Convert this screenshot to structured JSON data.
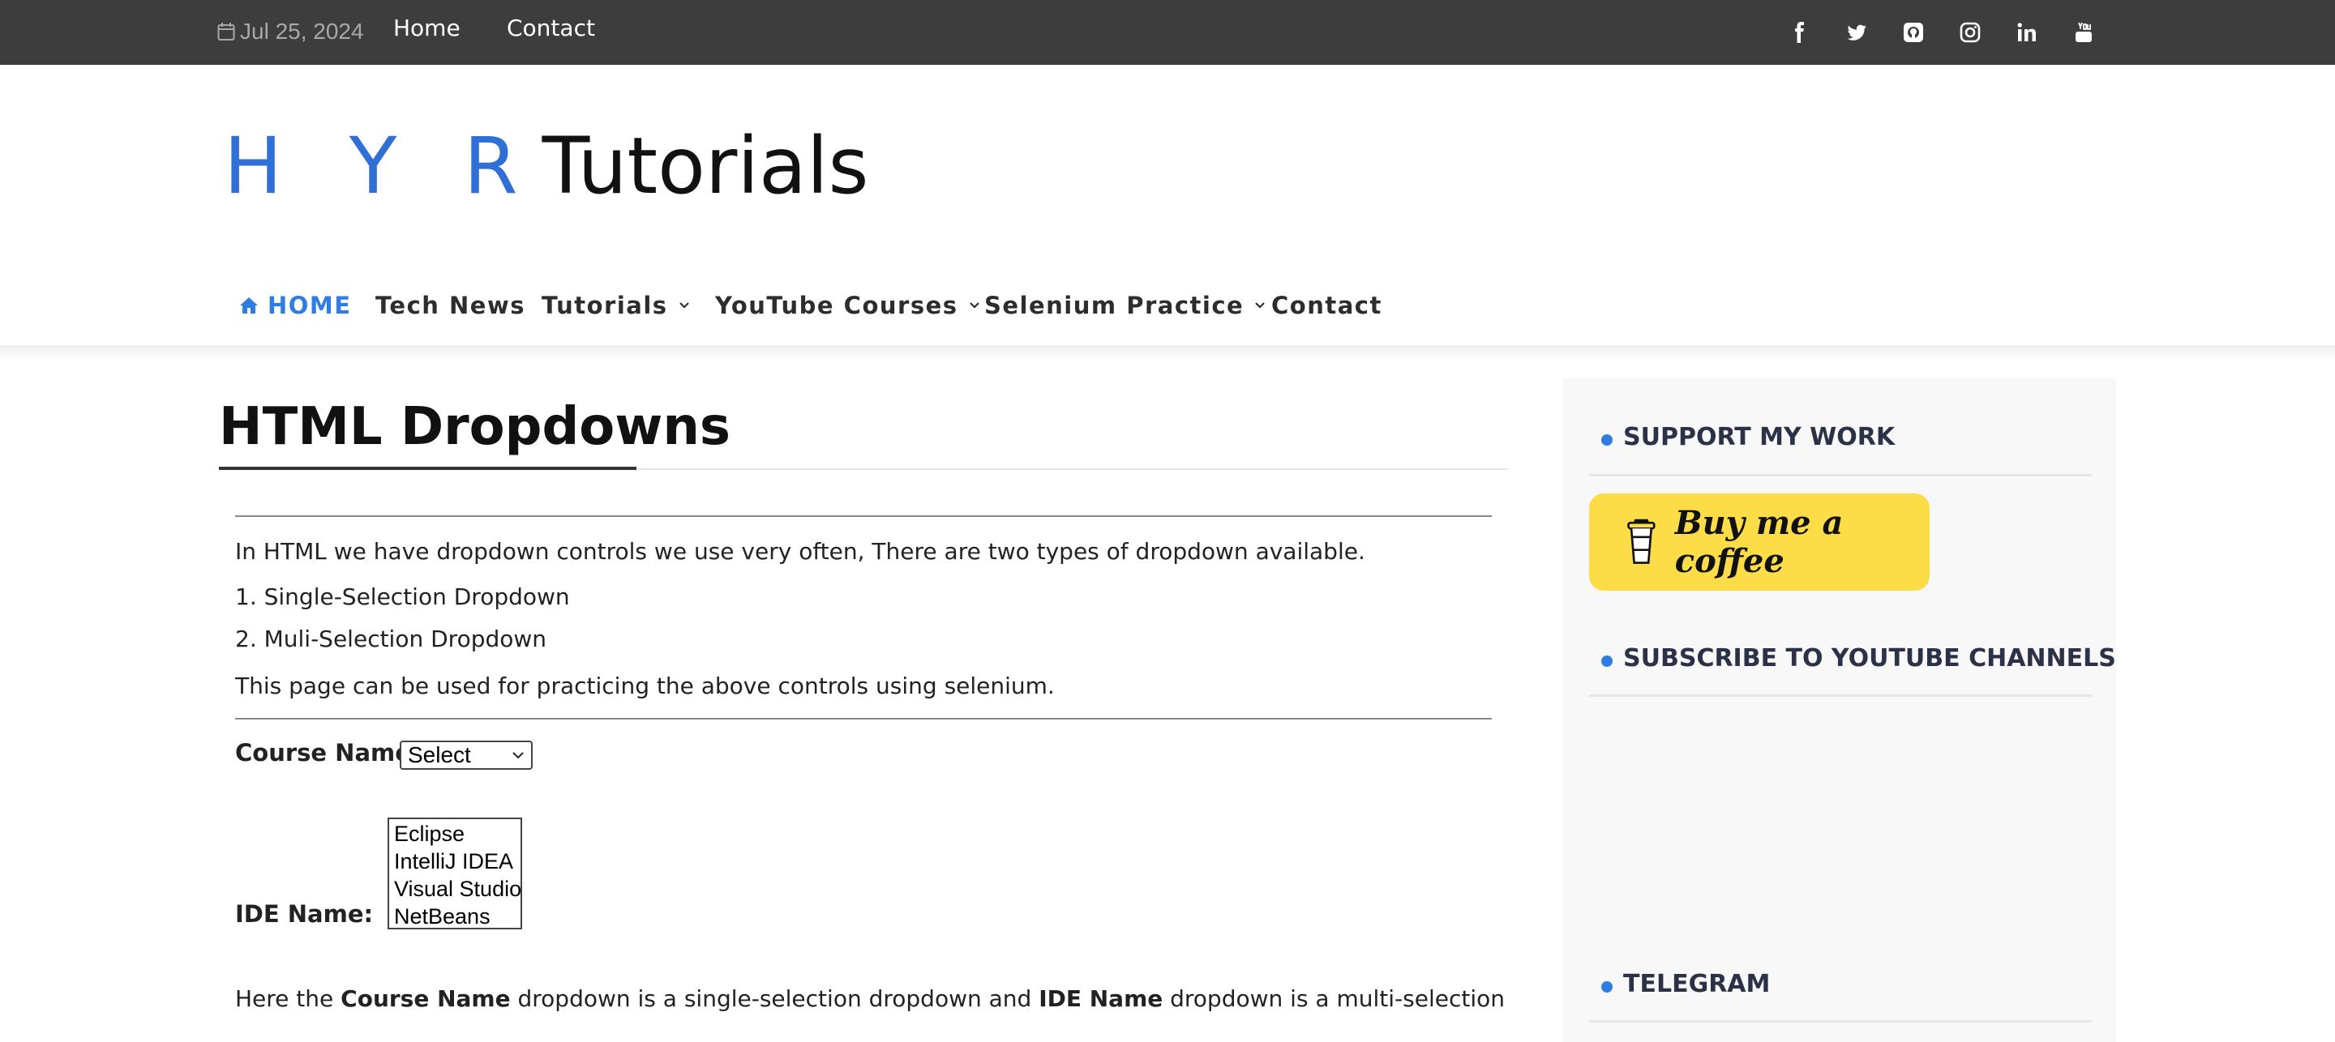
{
  "topbar": {
    "date": "Jul 25, 2024",
    "links": [
      "Home",
      "Contact"
    ],
    "social_icons": [
      "facebook-icon",
      "twitter-icon",
      "github-icon",
      "instagram-icon",
      "linkedin-icon",
      "youtube-icon"
    ]
  },
  "logo": {
    "hyr": "H Y R",
    "tutorials": "Tutorials"
  },
  "nav": {
    "home": "HOME",
    "tech_news": "Tech News",
    "tutorials": "Tutorials",
    "youtube_courses": "YouTube Courses",
    "selenium_practice": "Selenium Practice",
    "contact": "Contact"
  },
  "main": {
    "title": "HTML Dropdowns",
    "intro": "In HTML we have dropdown controls we use very often, There are two types of dropdown available.",
    "item1": "1. Single-Selection Dropdown",
    "item2": "2. Muli-Selection Dropdown",
    "usage": "This page can be used for practicing the above controls using selenium.",
    "course_label": "Course Name:",
    "course_selected": "Select",
    "ide_label": "IDE Name:",
    "ide_options": [
      "Eclipse",
      "IntelliJ IDEA",
      "Visual Studio",
      "NetBeans"
    ],
    "footer_text": {
      "p1": "Here the ",
      "b1": "Course Name",
      "p2": " dropdown is a single-selection dropdown and ",
      "b2": "IDE Name",
      "p3": " dropdown is a multi-selection"
    }
  },
  "sidebar": {
    "support_title": "SUPPORT MY WORK",
    "coffee_label": "Buy me a coffee",
    "subscribe_title": "SUBSCRIBE TO YOUTUBE CHANNELS",
    "telegram_title": "TELEGRAM"
  },
  "colors": {
    "topbar": "#3d3d3d",
    "accent": "#2f7de1",
    "coffee": "#fddd47",
    "sidebar_bg": "#f8f8f8"
  }
}
